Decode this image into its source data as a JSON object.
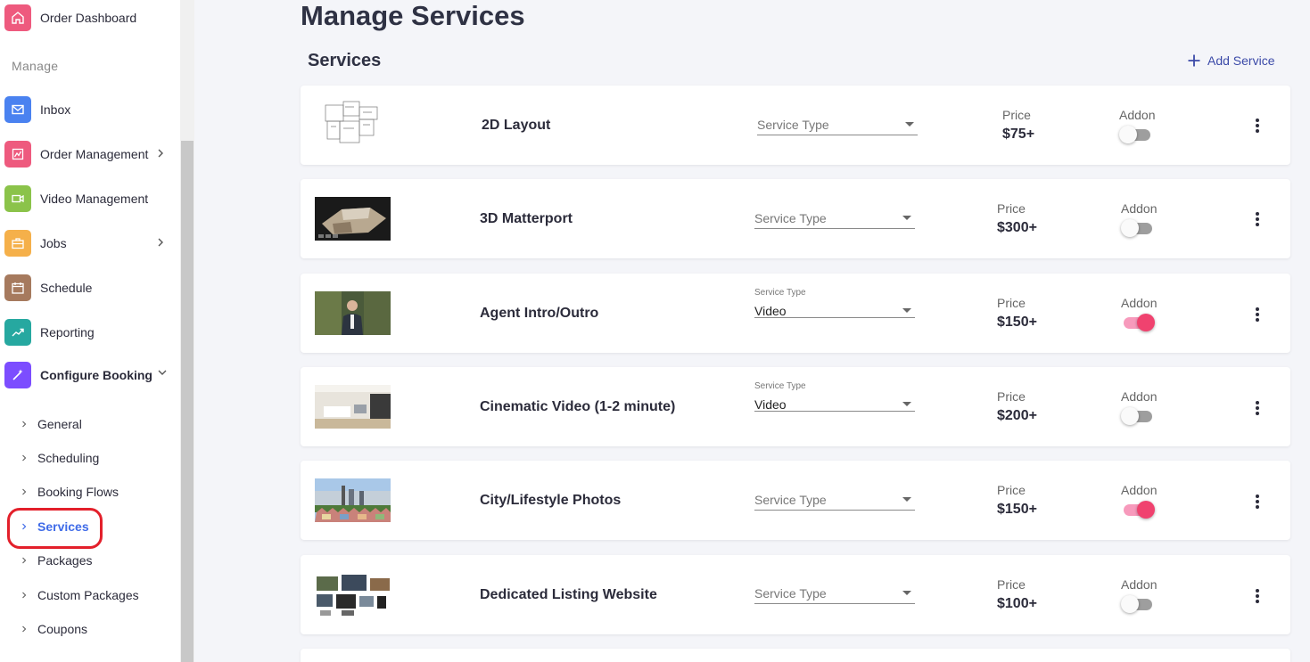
{
  "sidebar": {
    "top_item": {
      "label": "Order Dashboard",
      "icon": "home-icon",
      "color": "#ee5a7e"
    },
    "section_label": "Manage",
    "items": [
      {
        "label": "Inbox",
        "icon": "mail-icon",
        "color": "#4a82f0"
      },
      {
        "label": "Order Management",
        "icon": "orders-icon",
        "color": "#ee5a7e"
      },
      {
        "label": "Video Management",
        "icon": "video-icon",
        "color": "#8bc34a"
      },
      {
        "label": "Jobs",
        "icon": "briefcase-icon",
        "color": "#f5b04a"
      },
      {
        "label": "Schedule",
        "icon": "calendar-icon",
        "color": "#a67a5e"
      },
      {
        "label": "Reporting",
        "icon": "chart-icon",
        "color": "#26a8a0"
      },
      {
        "label": "Configure Booking",
        "icon": "wand-icon",
        "color": "#7c4dff"
      }
    ],
    "sub_items": [
      {
        "label": "General"
      },
      {
        "label": "Scheduling"
      },
      {
        "label": "Booking Flows"
      },
      {
        "label": "Services",
        "active": true
      },
      {
        "label": "Packages"
      },
      {
        "label": "Custom Packages"
      },
      {
        "label": "Coupons"
      }
    ]
  },
  "main": {
    "page_title": "Manage Services",
    "section_title": "Services",
    "add_service_label": "Add Service",
    "price_label": "Price",
    "addon_label": "Addon",
    "service_type_placeholder": "Service Type",
    "services": [
      {
        "name": "2D Layout",
        "service_type": "",
        "price": "$75+",
        "addon": false
      },
      {
        "name": "3D Matterport",
        "service_type": "",
        "price": "$300+",
        "addon": false
      },
      {
        "name": "Agent Intro/Outro",
        "service_type": "Video",
        "price": "$150+",
        "addon": true
      },
      {
        "name": "Cinematic Video (1-2 minute)",
        "service_type": "Video",
        "price": "$200+",
        "addon": false
      },
      {
        "name": "City/Lifestyle Photos",
        "service_type": "",
        "price": "$150+",
        "addon": true
      },
      {
        "name": "Dedicated Listing Website",
        "service_type": "",
        "price": "$100+",
        "addon": false
      }
    ]
  },
  "colors": {
    "accent": "#3f6be8",
    "toggle_on": "#f0426f",
    "active_ring": "#e3202b",
    "link": "#3b4aa8"
  }
}
